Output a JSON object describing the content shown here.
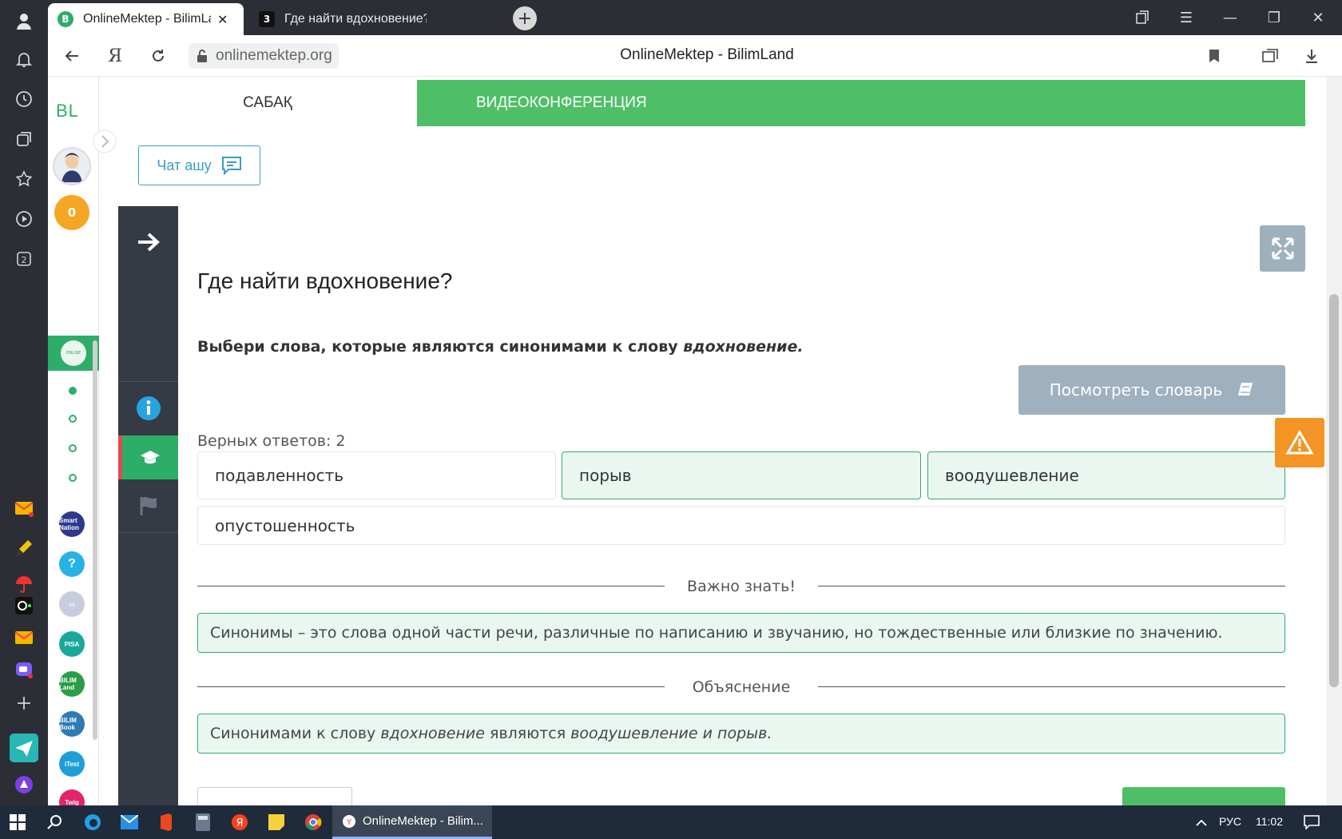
{
  "browser": {
    "tabs": [
      {
        "title": "OnlineMektep - BilimLand",
        "favicon": "B"
      },
      {
        "title": "Где найти вдохновение?BilimLand",
        "favicon": "3"
      }
    ],
    "url": "onlinemektep.org",
    "page_title": "OnlineMektep - BilimLand"
  },
  "sidebar": {
    "logo": "BL",
    "coins": "0",
    "apps": [
      "Smart Nation",
      "?",
      "",
      "PISA",
      "BILIM Land",
      "BILIM Book",
      "iTest",
      "Twig"
    ]
  },
  "page_tabs": {
    "lesson": "САБАҚ",
    "video": "ВИДЕОКОНФЕРЕНЦИЯ"
  },
  "chat_button": "Чат ашу",
  "lesson": {
    "title": "Где найти вдохновение?",
    "task_prefix": "Выбери слова, которые являются синонимами к слову ",
    "task_word": "вдохновение.",
    "dictionary_button": "Посмотреть словарь",
    "correct_answers": "Верных ответов: 2",
    "options": [
      {
        "text": "подавленность",
        "selected": false
      },
      {
        "text": "порыв",
        "selected": true
      },
      {
        "text": "воодушевление",
        "selected": true
      },
      {
        "text": "опустошенность",
        "selected": false
      }
    ],
    "important_label": "Важно знать!",
    "important_text": "Синонимы – это слова одной части речи, различные по написанию и звучанию, но тождественные или близкие по значению.",
    "explanation_label": "Объяснение",
    "explanation": {
      "p1": "Синонимами к слову ",
      "w1": "вдохновение",
      "p2": " являются ",
      "w2": "воодушевление и порыв."
    }
  },
  "taskbar": {
    "active_window": "OnlineMektep - Bilim...",
    "language": "РУС",
    "time": "11:02"
  },
  "colors": {
    "green": "#4fbf67",
    "dark": "#343b45",
    "warning": "#f39425",
    "accent_blue": "#3a9cc4"
  }
}
